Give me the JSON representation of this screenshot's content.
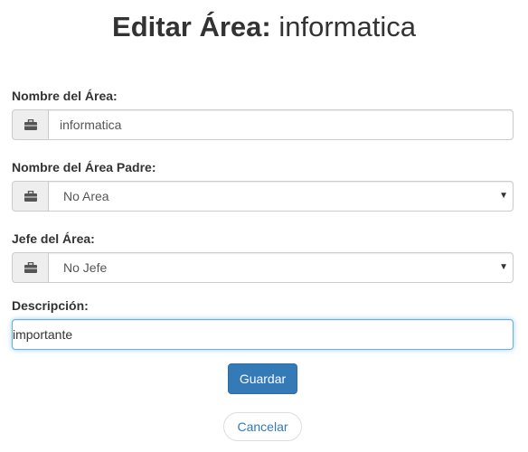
{
  "page": {
    "title_prefix": "Editar Área:",
    "title_name": "informatica"
  },
  "form": {
    "area_name": {
      "label": "Nombre del Área:",
      "value": "informatica",
      "icon": "briefcase-icon"
    },
    "parent_area": {
      "label": "Nombre del Área Padre:",
      "selected": "No Area",
      "icon": "briefcase-icon"
    },
    "area_head": {
      "label": "Jefe del Área:",
      "selected": "No Jefe",
      "icon": "briefcase-icon"
    },
    "description": {
      "label": "Descripción:",
      "value": "importante"
    }
  },
  "actions": {
    "save_label": "Guardar",
    "cancel_label": "Cancelar"
  },
  "colors": {
    "primary": "#337ab7",
    "focus_border": "#66afe9",
    "addon_bg": "#eeeeee"
  }
}
